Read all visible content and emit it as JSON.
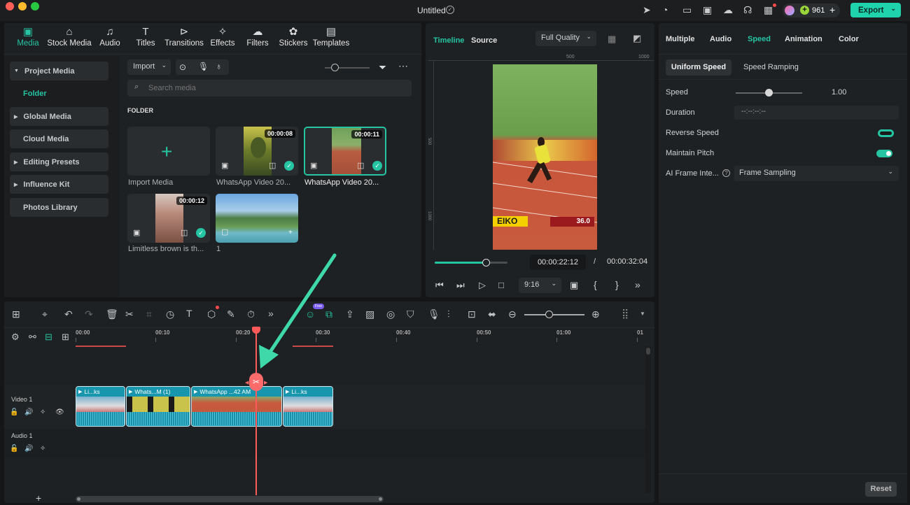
{
  "window": {
    "title": "Untitled",
    "credits": "961",
    "export_label": "Export"
  },
  "colors": {
    "accent": "#25c4a3",
    "playhead": "#ff4b4b",
    "panel": "#1e2123"
  },
  "media_tabs": [
    {
      "label": "Media",
      "icon": "media-icon"
    },
    {
      "label": "Stock Media",
      "icon": "stock-media-icon"
    },
    {
      "label": "Audio",
      "icon": "audio-icon"
    },
    {
      "label": "Titles",
      "icon": "titles-icon"
    },
    {
      "label": "Transitions",
      "icon": "transitions-icon"
    },
    {
      "label": "Effects",
      "icon": "effects-icon"
    },
    {
      "label": "Filters",
      "icon": "filters-icon"
    },
    {
      "label": "Stickers",
      "icon": "stickers-icon"
    },
    {
      "label": "Templates",
      "icon": "templates-icon"
    }
  ],
  "sidebar": {
    "project_media": "Project Media",
    "folder": "Folder",
    "global_media": "Global Media",
    "cloud_media": "Cloud Media",
    "editing_presets": "Editing Presets",
    "influence_kit": "Influence Kit",
    "photos_library": "Photos Library"
  },
  "media_toolbar": {
    "import_label": "Import",
    "search_placeholder": "Search media",
    "folder_heading": "FOLDER"
  },
  "media_items": {
    "import": "Import Media",
    "item1": {
      "caption": "WhatsApp Video 20...",
      "duration": "00:00:08"
    },
    "item2": {
      "caption": "WhatsApp Video 20...",
      "duration": "00:00:11"
    },
    "item3": {
      "caption": "Limitless brown is th...",
      "duration": "00:00:12"
    },
    "item4": {
      "caption": "1"
    }
  },
  "preview": {
    "tab_timeline": "Timeline",
    "tab_source": "Source",
    "quality": "Full Quality",
    "ruler": [
      "500",
      "1000"
    ],
    "ruler_v": [
      "500",
      "1000"
    ],
    "current_time": "00:00:22:12",
    "separator": "/",
    "total_time": "00:00:32:04",
    "aspect": "9:16",
    "scoreboard": "36.0",
    "sponsor": "EIKO",
    "progress": 0.7
  },
  "properties": {
    "tabs": [
      "Multiple",
      "Audio",
      "Speed",
      "Animation",
      "Color"
    ],
    "subtabs": [
      "Uniform Speed",
      "Speed Ramping"
    ],
    "speed_label": "Speed",
    "speed_value": "1.00",
    "duration_label": "Duration",
    "duration_value": "--:--:--:--",
    "reverse_label": "Reverse Speed",
    "pitch_label": "Maintain Pitch",
    "ai_label": "AI Frame Inte...",
    "ai_value": "Frame Sampling",
    "reset": "Reset"
  },
  "timeline": {
    "ruler": [
      "00:00",
      "00:10",
      "00:20",
      "00:30",
      "00:40",
      "00:50",
      "01:00",
      "01"
    ],
    "free_badge": "Free",
    "video_track": "Video 1",
    "audio_track": "Audio 1",
    "clips": [
      {
        "label": "Li...ks"
      },
      {
        "label": "Whats...M (1)"
      },
      {
        "label": "WhatsApp ...42 AM"
      },
      {
        "label": "Li...ks"
      }
    ],
    "add": "+"
  }
}
